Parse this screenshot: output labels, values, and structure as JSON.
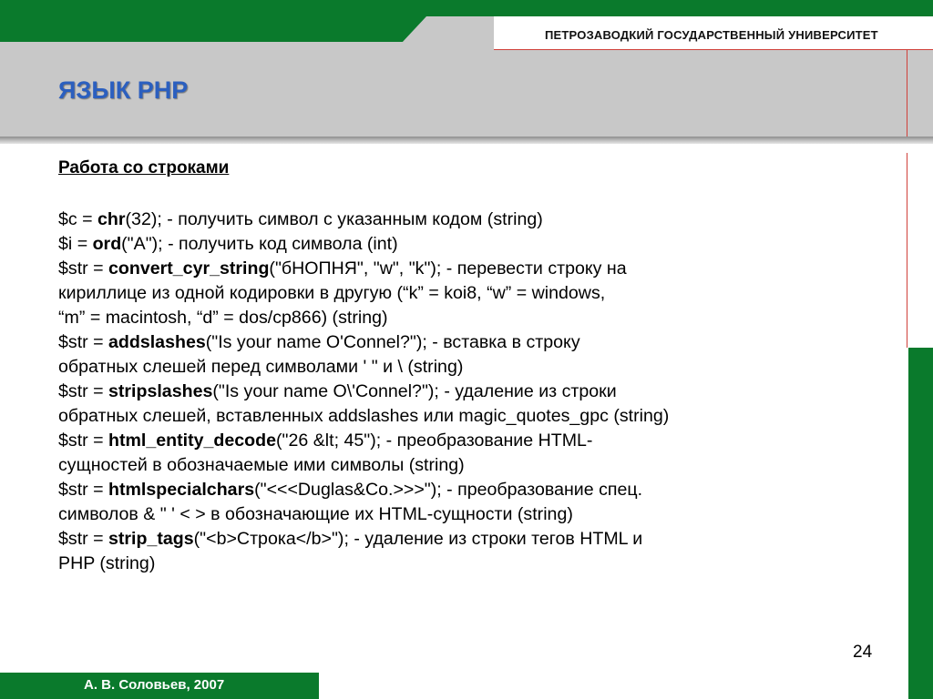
{
  "header": {
    "university": "ПЕТРОЗАВОДКИЙ ГОСУДАРСТВЕННЫЙ УНИВЕРСИТЕТ",
    "title": "ЯЗЫК PHP"
  },
  "section": {
    "title": "Работа со строками"
  },
  "lines": [
    {
      "pre": "$c = ",
      "fn": "chr",
      "post": "(32); - получить символ с указанным кодом (string)"
    },
    {
      "pre": "$i = ",
      "fn": "ord",
      "post": "(\"A\"); - получить код символа (int)"
    },
    {
      "pre": "$str = ",
      "fn": "convert_cyr_string",
      "post": "(\"бНОПНЯ\", \"w\", \"k\"); - перевести строку на"
    },
    {
      "pre": "кириллице из одной кодировки в другую (“k” = koi8, “w” = windows,",
      "fn": "",
      "post": ""
    },
    {
      "pre": "“m” = macintosh, “d” = dos/cp866) (string)",
      "fn": "",
      "post": ""
    },
    {
      "pre": "$str = ",
      "fn": "addslashes",
      "post": "(\"Is your name O'Connel?\"); - вставка в строку"
    },
    {
      "pre": "обратных слешей перед символами ' \" и \\ (string)",
      "fn": "",
      "post": ""
    },
    {
      "pre": "$str = ",
      "fn": "stripslashes",
      "post": "(\"Is your name O\\'Connel?\"); - удаление из строки"
    },
    {
      "pre": "обратных слешей, вставленных addslashes или magic_quotes_gpc (string)",
      "fn": "",
      "post": ""
    },
    {
      "pre": "$str = ",
      "fn": "html_entity_decode",
      "post": "(\"26 &lt; 45\"); - преобразование HTML-"
    },
    {
      "pre": "сущностей в обозначаемые ими символы (string)",
      "fn": "",
      "post": ""
    },
    {
      "pre": "$str = ",
      "fn": "htmlspecialchars",
      "post": "(\"<<<Duglas&Co.>>>\"); - преобразование спец."
    },
    {
      "pre": "символов & \" ' < > в обозначающие их HTML-сущности (string)",
      "fn": "",
      "post": ""
    },
    {
      "pre": "$str = ",
      "fn": "strip_tags",
      "post": "(\"<b>Строка</b>\"); - удаление из строки тегов HTML и"
    },
    {
      "pre": "PHP (string)",
      "fn": "",
      "post": ""
    }
  ],
  "footer": {
    "page_number": "24",
    "author": "А. В. Соловьев, 2007"
  },
  "colors": {
    "green": "#0a7a2c",
    "title_blue": "#2b5fbf",
    "band_gray": "#c8c8c8",
    "accent_red": "#d0403a"
  }
}
